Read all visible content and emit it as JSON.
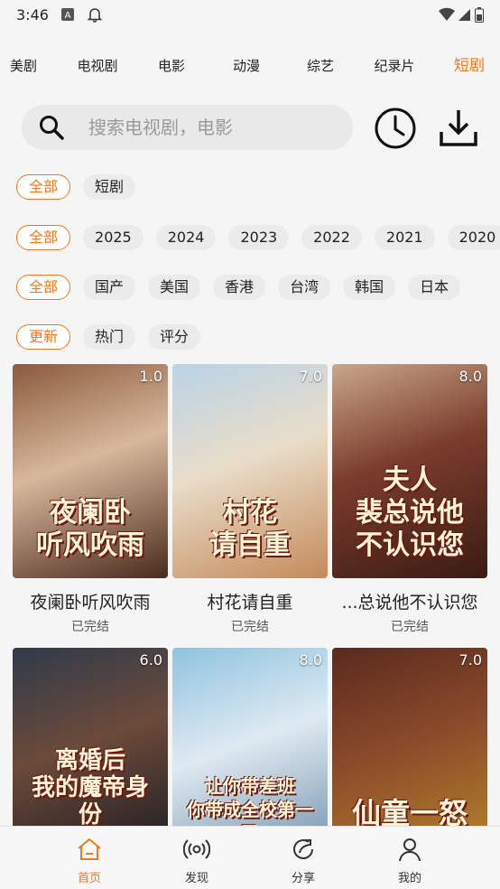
{
  "status_bar": {
    "time": "3:46"
  },
  "top_tabs": [
    {
      "label": "美剧",
      "active": false
    },
    {
      "label": "电视剧",
      "active": false
    },
    {
      "label": "电影",
      "active": false
    },
    {
      "label": "动漫",
      "active": false
    },
    {
      "label": "综艺",
      "active": false
    },
    {
      "label": "纪录片",
      "active": false
    },
    {
      "label": "短剧",
      "active": true
    }
  ],
  "search": {
    "placeholder": "搜索电视剧，电影"
  },
  "filters": {
    "type": [
      "全部",
      "短剧"
    ],
    "year": [
      "全部",
      "2025",
      "2024",
      "2023",
      "2022",
      "2021",
      "2020"
    ],
    "region": [
      "全部",
      "国产",
      "美国",
      "香港",
      "台湾",
      "韩国",
      "日本"
    ],
    "sort": [
      "更新",
      "热门",
      "评分"
    ]
  },
  "cards": [
    {
      "title": "夜阑卧听风吹雨",
      "status": "已完结",
      "rating": "1.0",
      "poster_text": "夜阑卧\n听风吹雨",
      "colors": [
        "#8a5a3c",
        "#d8b89c",
        "#4a2a1c"
      ]
    },
    {
      "title": "村花请自重",
      "status": "已完结",
      "rating": "7.0",
      "poster_text": "村花\n请自重",
      "colors": [
        "#b9d3e6",
        "#e9ddc9",
        "#c48a5a"
      ]
    },
    {
      "title": "...总说他不认识您",
      "status": "已完结",
      "rating": "8.0",
      "poster_text": "夫人\n裴总说他\n不认识您",
      "colors": [
        "#c9a78a",
        "#7a3b2c",
        "#3a1c14"
      ]
    },
    {
      "title": "",
      "status": "",
      "rating": "6.0",
      "poster_text": "离婚后\n我的魔帝身份\n藏不住了",
      "colors": [
        "#2f3a4a",
        "#6b4a3a",
        "#1a1a22"
      ]
    },
    {
      "title": "",
      "status": "",
      "rating": "8.0",
      "poster_text": "让你带差班\n你带成全校第一了",
      "colors": [
        "#8fc3e0",
        "#dfeaf2",
        "#6f8fa8"
      ]
    },
    {
      "title": "",
      "status": "",
      "rating": "7.0",
      "poster_text": "仙童一怒",
      "colors": [
        "#5a2a1e",
        "#8a4a2a",
        "#b8862a"
      ]
    }
  ],
  "bottom_nav": [
    {
      "label": "首页",
      "icon": "home-icon",
      "active": true
    },
    {
      "label": "发现",
      "icon": "broadcast-icon",
      "active": false
    },
    {
      "label": "分享",
      "icon": "share-icon",
      "active": false
    },
    {
      "label": "我的",
      "icon": "user-icon",
      "active": false
    }
  ],
  "accent": "#f07a22"
}
